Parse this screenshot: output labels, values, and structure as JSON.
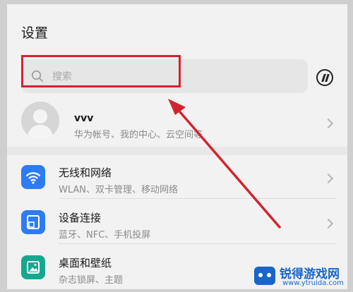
{
  "header": {
    "title": "设置"
  },
  "search": {
    "placeholder": "搜索",
    "icon": "search-icon"
  },
  "badge": {
    "icon": "huawei-logo-icon"
  },
  "account": {
    "name": "vvv",
    "subtitle": "华为帐号、我的中心、云空间等"
  },
  "settings_items": [
    {
      "title": "无线和网络",
      "subtitle": "WLAN、双卡管理、移动网络",
      "icon": "wifi-icon",
      "color": "#2d7cf6"
    },
    {
      "title": "设备连接",
      "subtitle": "蓝牙、NFC、手机投屏",
      "icon": "device-connect-icon",
      "color": "#2d7cf6"
    },
    {
      "title": "桌面和壁纸",
      "subtitle": "杂志锁屏、主题",
      "icon": "wallpaper-icon",
      "color": "#14a88f"
    }
  ],
  "annotation": {
    "box_color": "#d3232f",
    "arrow_color": "#d3232f"
  },
  "watermark": {
    "title": "锐得游戏网",
    "url": "www.ytruida.com"
  }
}
